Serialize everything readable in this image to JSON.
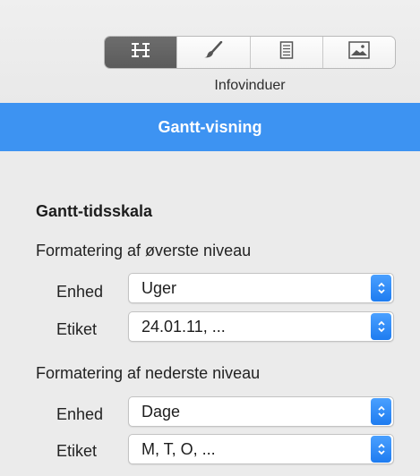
{
  "toolbar": {
    "caption": "Infovinduer",
    "buttons": [
      {
        "icon": "gantt-view-icon",
        "active": true
      },
      {
        "icon": "paintbrush-icon",
        "active": false
      },
      {
        "icon": "document-icon",
        "active": false
      },
      {
        "icon": "image-icon",
        "active": false
      }
    ]
  },
  "banner": {
    "title": "Gantt-visning"
  },
  "section": {
    "title": "Gantt-tidsskala"
  },
  "top_level": {
    "title": "Formatering af øverste niveau",
    "unit_label": "Enhed",
    "unit_value": "Uger",
    "label_label": "Etiket",
    "label_value": "24.01.11, ..."
  },
  "bottom_level": {
    "title": "Formatering af nederste niveau",
    "unit_label": "Enhed",
    "unit_value": "Dage",
    "label_label": "Etiket",
    "label_value": "M, T, O, ..."
  },
  "colors": {
    "accent": "#3d93f2",
    "panel_bg": "#ebebeb",
    "active_segment": "#626262"
  }
}
